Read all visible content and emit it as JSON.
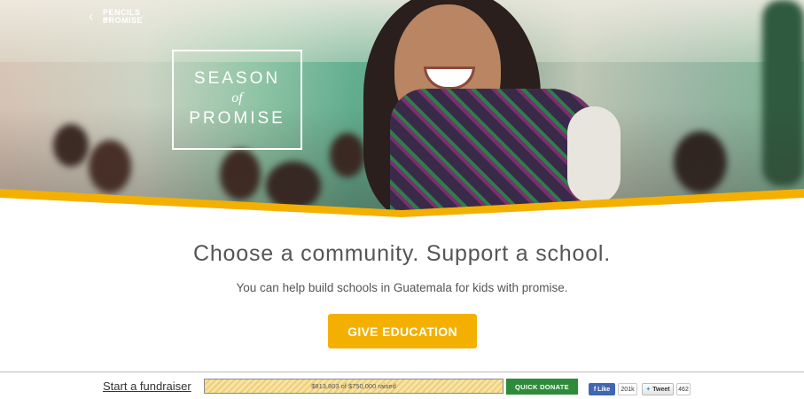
{
  "hero": {
    "logo": {
      "line1": "PENCILS of",
      "line2": "PROMISE",
      "icon": "chevron-left-icon"
    },
    "campaign": {
      "word1": "SEASON",
      "word2": "of",
      "word3": "PROMISE"
    }
  },
  "main": {
    "headline": "Choose a community. Support a school.",
    "subline": "You can help build schools in Guatemala for kids with promise.",
    "cta_label": "GIVE EDUCATION"
  },
  "footer": {
    "fundraiser_label": "Start a fundraiser",
    "progress_text": "$813,803 of $750,000 raised",
    "progress_fraction": 1.0,
    "quick_donate_label": "QUICK DONATE",
    "fb_like_label": "Like",
    "fb_like_count": "201k",
    "tweet_label": "Tweet",
    "tweet_count": "462"
  },
  "colors": {
    "accent_yellow": "#f4b000",
    "donate_green": "#2e8b3a",
    "facebook_blue": "#4267b2"
  }
}
